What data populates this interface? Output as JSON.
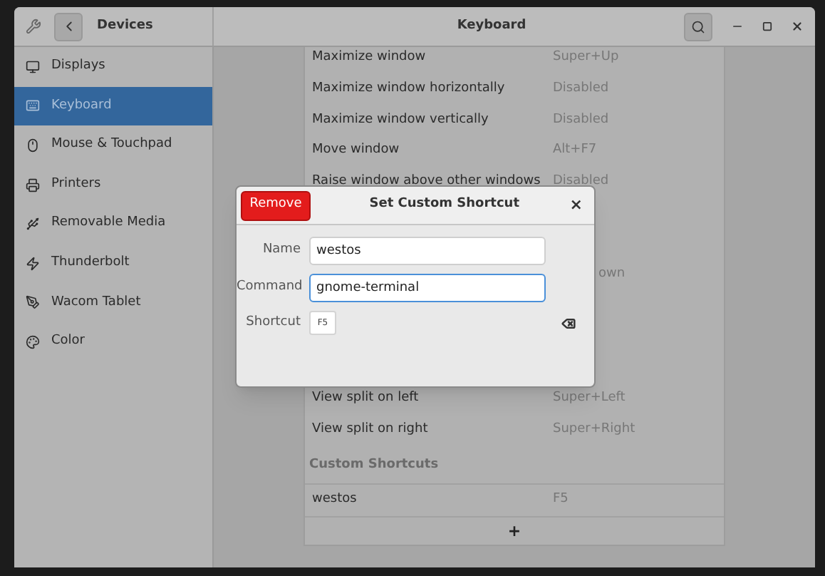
{
  "header": {
    "sidebar_title": "Devices",
    "title": "Keyboard"
  },
  "sidebar": {
    "items": [
      {
        "label": "Displays",
        "selected": false
      },
      {
        "label": "Keyboard",
        "selected": true
      },
      {
        "label": "Mouse & Touchpad",
        "selected": false
      },
      {
        "label": "Printers",
        "selected": false
      },
      {
        "label": "Removable Media",
        "selected": false
      },
      {
        "label": "Thunderbolt",
        "selected": false
      },
      {
        "label": "Wacom Tablet",
        "selected": false
      },
      {
        "label": "Color",
        "selected": false
      }
    ]
  },
  "shortcuts": {
    "rows_above": [
      {
        "label": "Maximize window",
        "value": "Super+Up"
      },
      {
        "label": "Maximize window horizontally",
        "value": "Disabled"
      },
      {
        "label": "Maximize window vertically",
        "value": "Disabled"
      },
      {
        "label": "Move window",
        "value": "Alt+F7"
      },
      {
        "label": "Raise window above other windows",
        "value": "Disabled"
      }
    ],
    "covered_value": "own",
    "rows_below": [
      {
        "label": "View split on left",
        "value": "Super+Left"
      },
      {
        "label": "View split on right",
        "value": "Super+Right"
      }
    ],
    "custom_title": "Custom Shortcuts",
    "custom_rows": [
      {
        "label": "westos",
        "value": "F5"
      }
    ],
    "add_label": "+"
  },
  "dialog": {
    "remove": "Remove",
    "title": "Set Custom Shortcut",
    "close": "×",
    "fields": [
      {
        "label": "Name",
        "value": "westos",
        "focused": false
      },
      {
        "label": "Command",
        "value": "gnome-terminal",
        "focused": true
      }
    ],
    "shortcut_label": "Shortcut",
    "shortcut_key": "F5"
  }
}
